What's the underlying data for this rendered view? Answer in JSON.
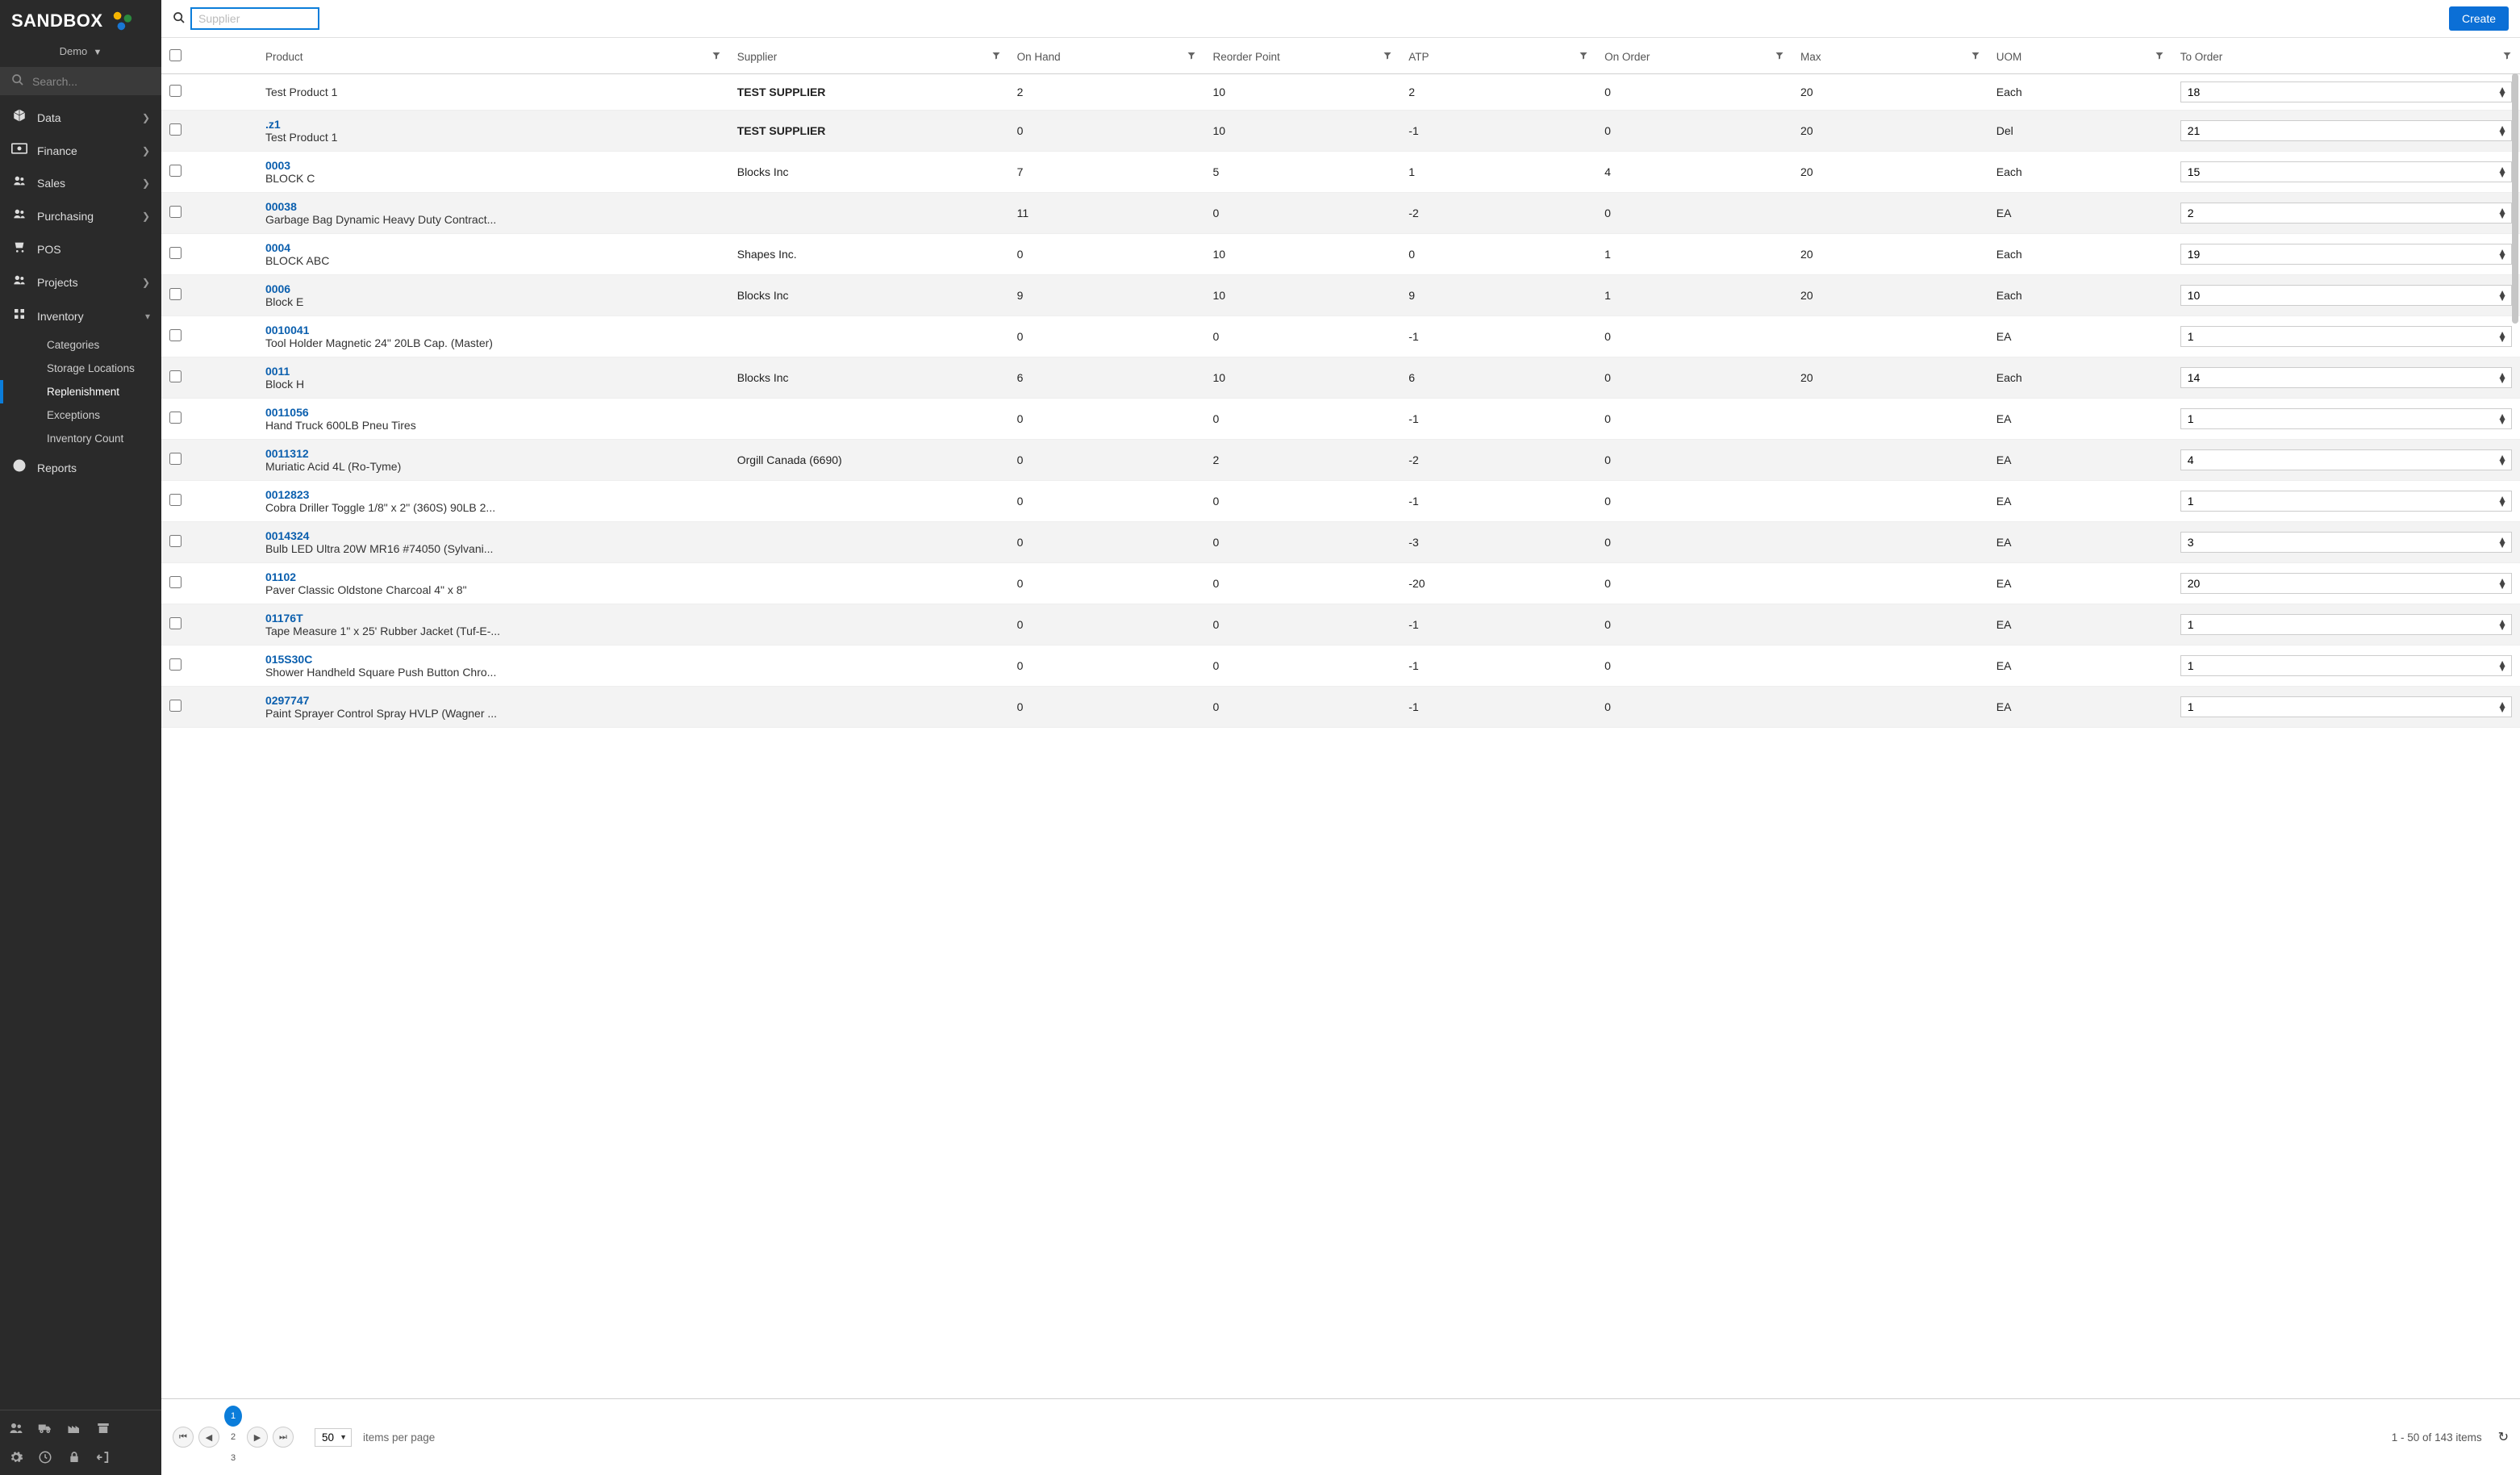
{
  "brand": "SANDBOX",
  "org": {
    "name": "Demo"
  },
  "sidebar": {
    "search_placeholder": "Search...",
    "items": [
      {
        "icon": "cube",
        "label": "Data",
        "expandable": true
      },
      {
        "icon": "money",
        "label": "Finance",
        "expandable": true
      },
      {
        "icon": "users",
        "label": "Sales",
        "expandable": true
      },
      {
        "icon": "users",
        "label": "Purchasing",
        "expandable": true
      },
      {
        "icon": "cart",
        "label": "POS",
        "expandable": false
      },
      {
        "icon": "users",
        "label": "Projects",
        "expandable": true
      },
      {
        "icon": "globe",
        "label": "Inventory",
        "expandable": true,
        "open": true,
        "children": [
          {
            "label": "Categories"
          },
          {
            "label": "Storage Locations"
          },
          {
            "label": "Replenishment",
            "active": true
          },
          {
            "label": "Exceptions"
          },
          {
            "label": "Inventory Count"
          }
        ]
      },
      {
        "icon": "pie",
        "label": "Reports",
        "expandable": false
      }
    ]
  },
  "toolbar": {
    "search_placeholder": "Supplier",
    "create_label": "Create"
  },
  "columns": [
    "Product",
    "Supplier",
    "On Hand",
    "Reorder Point",
    "ATP",
    "On Order",
    "Max",
    "UOM",
    "To Order"
  ],
  "rows": [
    {
      "sku": "",
      "name": "Test Product 1",
      "supplier": "TEST SUPPLIER",
      "sup_strong": true,
      "on_hand": "2",
      "reorder": "10",
      "atp": "2",
      "on_order": "0",
      "max": "20",
      "uom": "Each",
      "to_order": "18"
    },
    {
      "sku": ".z1",
      "name": "Test Product 1",
      "supplier": "TEST SUPPLIER",
      "sup_strong": true,
      "on_hand": "0",
      "reorder": "10",
      "atp": "-1",
      "on_order": "0",
      "max": "20",
      "uom": "Del",
      "to_order": "21"
    },
    {
      "sku": "0003",
      "name": "BLOCK C",
      "supplier": "Blocks Inc",
      "on_hand": "7",
      "reorder": "5",
      "atp": "1",
      "on_order": "4",
      "max": "20",
      "uom": "Each",
      "to_order": "15"
    },
    {
      "sku": "00038",
      "name": "Garbage Bag Dynamic Heavy Duty Contract...",
      "supplier": "",
      "on_hand": "11",
      "reorder": "0",
      "atp": "-2",
      "on_order": "0",
      "max": "",
      "uom": "EA",
      "to_order": "2"
    },
    {
      "sku": "0004",
      "name": "BLOCK ABC",
      "supplier": "Shapes Inc.",
      "on_hand": "0",
      "reorder": "10",
      "atp": "0",
      "on_order": "1",
      "max": "20",
      "uom": "Each",
      "to_order": "19"
    },
    {
      "sku": "0006",
      "name": "Block E",
      "supplier": "Blocks Inc",
      "on_hand": "9",
      "reorder": "10",
      "atp": "9",
      "on_order": "1",
      "max": "20",
      "uom": "Each",
      "to_order": "10"
    },
    {
      "sku": "0010041",
      "name": "Tool Holder Magnetic 24\" 20LB Cap. (Master)",
      "supplier": "",
      "on_hand": "0",
      "reorder": "0",
      "atp": "-1",
      "on_order": "0",
      "max": "",
      "uom": "EA",
      "to_order": "1"
    },
    {
      "sku": "0011",
      "name": "Block H",
      "supplier": "Blocks Inc",
      "on_hand": "6",
      "reorder": "10",
      "atp": "6",
      "on_order": "0",
      "max": "20",
      "uom": "Each",
      "to_order": "14"
    },
    {
      "sku": "0011056",
      "name": "Hand Truck 600LB Pneu Tires",
      "supplier": "",
      "on_hand": "0",
      "reorder": "0",
      "atp": "-1",
      "on_order": "0",
      "max": "",
      "uom": "EA",
      "to_order": "1"
    },
    {
      "sku": "0011312",
      "name": "Muriatic Acid 4L (Ro-Tyme)",
      "supplier": "Orgill Canada (6690)",
      "on_hand": "0",
      "reorder": "2",
      "atp": "-2",
      "on_order": "0",
      "max": "",
      "uom": "EA",
      "to_order": "4"
    },
    {
      "sku": "0012823",
      "name": "Cobra Driller Toggle 1/8\" x 2\" (360S) 90LB 2...",
      "supplier": "",
      "on_hand": "0",
      "reorder": "0",
      "atp": "-1",
      "on_order": "0",
      "max": "",
      "uom": "EA",
      "to_order": "1"
    },
    {
      "sku": "0014324",
      "name": "Bulb LED Ultra 20W MR16 #74050 (Sylvani...",
      "supplier": "",
      "on_hand": "0",
      "reorder": "0",
      "atp": "-3",
      "on_order": "0",
      "max": "",
      "uom": "EA",
      "to_order": "3"
    },
    {
      "sku": "01102",
      "name": "Paver Classic Oldstone Charcoal 4\" x 8\"",
      "supplier": "",
      "on_hand": "0",
      "reorder": "0",
      "atp": "-20",
      "on_order": "0",
      "max": "",
      "uom": "EA",
      "to_order": "20"
    },
    {
      "sku": "01176T",
      "name": "Tape Measure 1\" x 25' Rubber Jacket (Tuf-E-...",
      "supplier": "",
      "on_hand": "0",
      "reorder": "0",
      "atp": "-1",
      "on_order": "0",
      "max": "",
      "uom": "EA",
      "to_order": "1"
    },
    {
      "sku": "015S30C",
      "name": "Shower Handheld Square Push Button Chro...",
      "supplier": "",
      "on_hand": "0",
      "reorder": "0",
      "atp": "-1",
      "on_order": "0",
      "max": "",
      "uom": "EA",
      "to_order": "1"
    },
    {
      "sku": "0297747",
      "name": "Paint Sprayer Control Spray HVLP (Wagner ...",
      "supplier": "",
      "on_hand": "0",
      "reorder": "0",
      "atp": "-1",
      "on_order": "0",
      "max": "",
      "uom": "EA",
      "to_order": "1"
    }
  ],
  "pager": {
    "pages": [
      "1",
      "2",
      "3"
    ],
    "active": 1,
    "page_size": "50",
    "per_page_label": "items per page",
    "count_label": "1 - 50 of 143 items"
  }
}
